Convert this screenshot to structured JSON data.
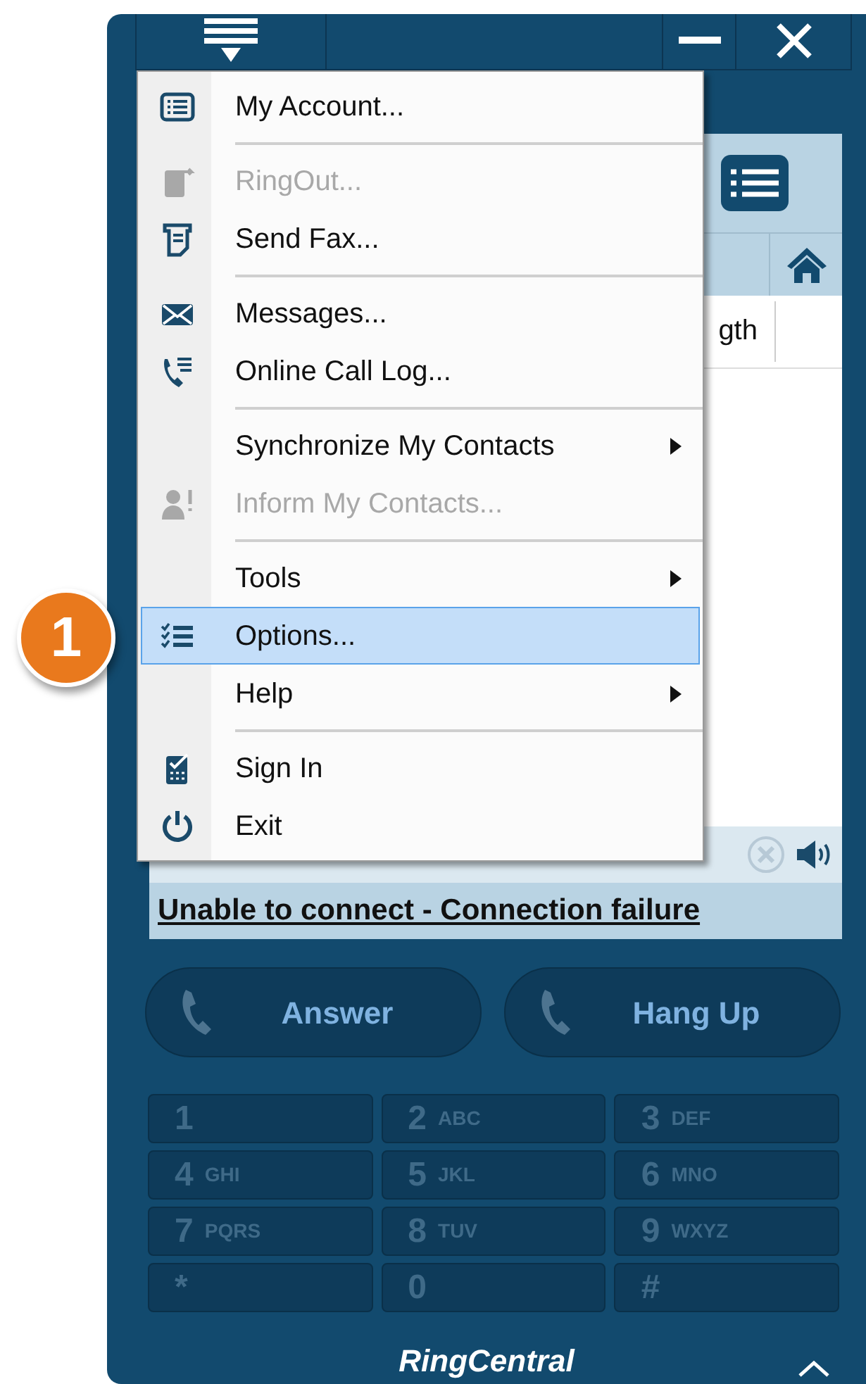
{
  "panel": {
    "column_header": "gth",
    "status": "Unable to connect - Connection failure"
  },
  "menu": [
    {
      "kind": "item",
      "label": "My Account...",
      "disabled": false,
      "submenu": false,
      "selected": false
    },
    {
      "kind": "separator"
    },
    {
      "kind": "item",
      "label": "RingOut...",
      "disabled": true,
      "submenu": false,
      "selected": false
    },
    {
      "kind": "item",
      "label": "Send Fax...",
      "disabled": false,
      "submenu": false,
      "selected": false
    },
    {
      "kind": "separator"
    },
    {
      "kind": "item",
      "label": "Messages...",
      "disabled": false,
      "submenu": false,
      "selected": false
    },
    {
      "kind": "item",
      "label": "Online Call Log...",
      "disabled": false,
      "submenu": false,
      "selected": false
    },
    {
      "kind": "separator"
    },
    {
      "kind": "item",
      "label": "Synchronize My Contacts",
      "disabled": false,
      "submenu": true,
      "selected": false
    },
    {
      "kind": "item",
      "label": "Inform My Contacts...",
      "disabled": true,
      "submenu": false,
      "selected": false
    },
    {
      "kind": "separator"
    },
    {
      "kind": "item",
      "label": "Tools",
      "disabled": false,
      "submenu": true,
      "selected": false
    },
    {
      "kind": "item",
      "label": "Options...",
      "disabled": false,
      "submenu": false,
      "selected": true
    },
    {
      "kind": "item",
      "label": "Help",
      "disabled": false,
      "submenu": true,
      "selected": false
    },
    {
      "kind": "separator"
    },
    {
      "kind": "item",
      "label": "Sign In",
      "disabled": false,
      "submenu": false,
      "selected": false
    },
    {
      "kind": "item",
      "label": "Exit",
      "disabled": false,
      "submenu": false,
      "selected": false
    }
  ],
  "step_badge": "1",
  "call_buttons": [
    "Answer",
    "Hang Up"
  ],
  "keypad": [
    {
      "digit": "1"
    },
    {
      "digit": "2",
      "letters": "ABC"
    },
    {
      "digit": "3",
      "letters": "DEF"
    },
    {
      "digit": "4",
      "letters": "GHI"
    },
    {
      "digit": "5",
      "letters": "JKL"
    },
    {
      "digit": "6",
      "letters": "MNO"
    },
    {
      "digit": "7",
      "letters": "PQRS"
    },
    {
      "digit": "8",
      "letters": "TUV"
    },
    {
      "digit": "9",
      "letters": "WXYZ"
    },
    {
      "digit": "*"
    },
    {
      "digit": "0"
    },
    {
      "digit": "#"
    }
  ],
  "logo": "RingCentral"
}
